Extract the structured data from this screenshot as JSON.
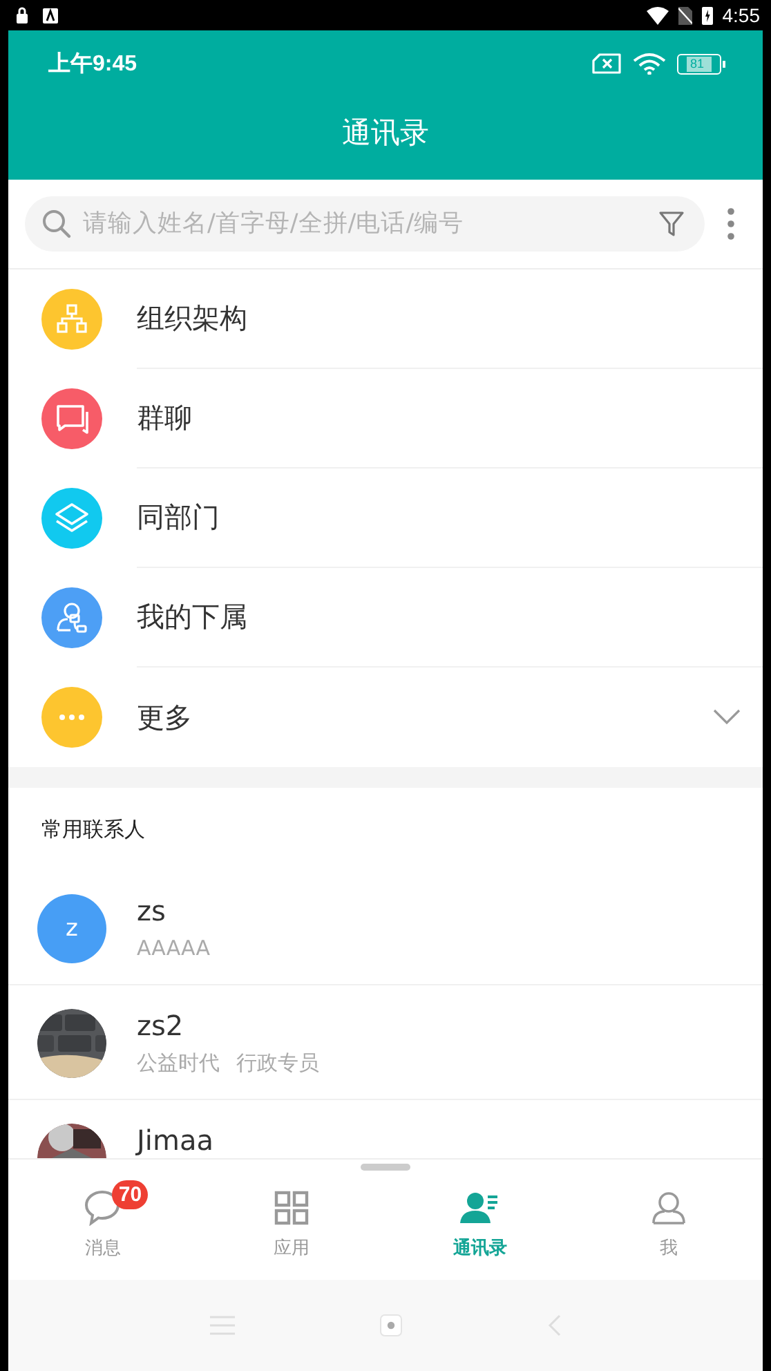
{
  "device_status": {
    "time": "4:55"
  },
  "app_status": {
    "time": "上午9:45",
    "battery": "81"
  },
  "title": "通讯录",
  "search": {
    "placeholder": "请输入姓名/首字母/全拼/电话/编号"
  },
  "menu": [
    {
      "kind": "org",
      "label": "组织架构",
      "color": "#fdc52f"
    },
    {
      "kind": "group",
      "label": "群聊",
      "color": "#f75c68"
    },
    {
      "kind": "layers",
      "label": "同部门",
      "color": "#11c9ef"
    },
    {
      "kind": "subordinate",
      "label": "我的下属",
      "color": "#4d9ff5"
    }
  ],
  "more_row": {
    "label": "更多",
    "expanded": false
  },
  "section_title": "常用联系人",
  "contacts": [
    {
      "kind": "initial",
      "initial": "z",
      "name": "zs",
      "details": [
        "AAAAA"
      ]
    },
    {
      "kind": "picture",
      "name": "zs2",
      "details": [
        "公益时代",
        "行政专员"
      ]
    },
    {
      "kind": "picture",
      "name": "Jimaa"
    }
  ],
  "tabs": [
    {
      "kind": "message",
      "label": "消息",
      "badge": "70",
      "selected": false
    },
    {
      "kind": "apps",
      "label": "应用",
      "selected": false
    },
    {
      "kind": "contacts",
      "label": "通讯录",
      "selected": true
    },
    {
      "kind": "me",
      "label": "我",
      "selected": false
    }
  ]
}
